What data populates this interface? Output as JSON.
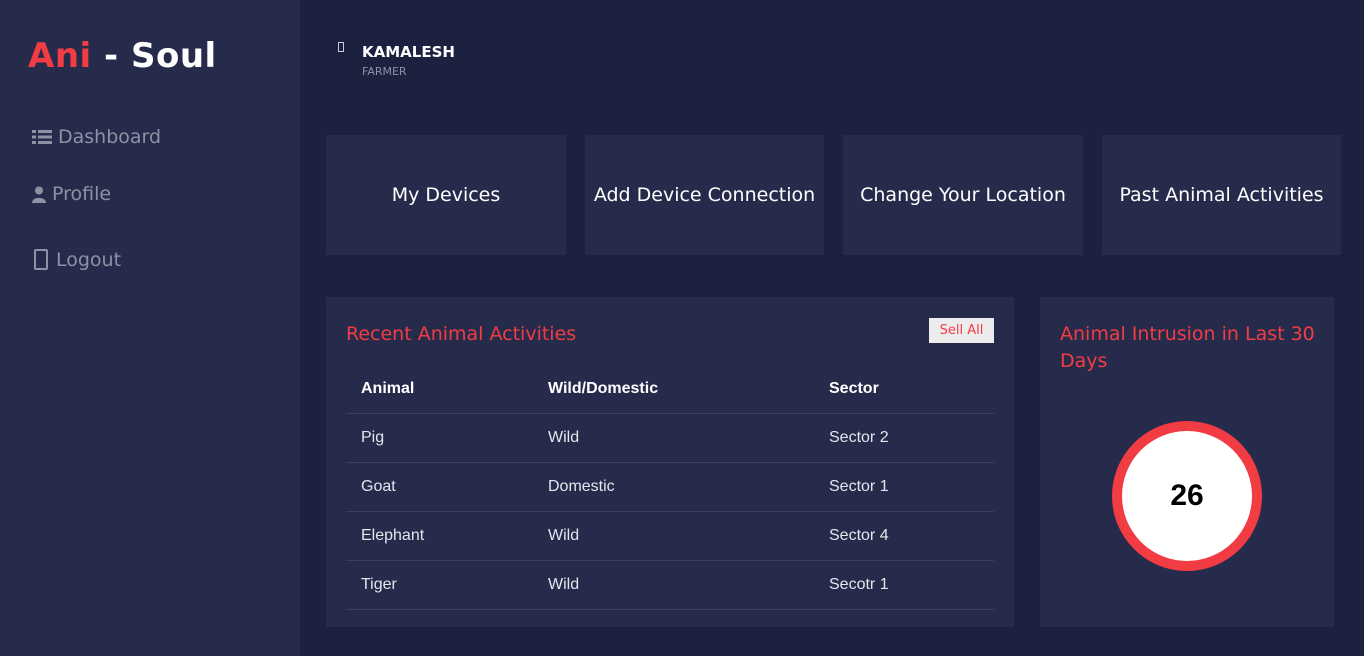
{
  "brand": {
    "accent": "Ani",
    "rest": " - Soul",
    "accent_color": "#f23c44"
  },
  "sidebar": {
    "items": [
      {
        "label": "Dashboard",
        "icon": "list-icon"
      },
      {
        "label": "Profile",
        "icon": "user-icon"
      },
      {
        "label": "Logout",
        "icon": "phone-icon"
      }
    ]
  },
  "user": {
    "name": "KAMALESH",
    "role": "FARMER"
  },
  "quick_actions": [
    {
      "label": "My Devices"
    },
    {
      "label": "Add Device Connection"
    },
    {
      "label": "Change Your Location"
    },
    {
      "label": "Past Animal Activities"
    }
  ],
  "recent_activities": {
    "title": "Recent Animal Activities",
    "see_all_label": "Sell All",
    "columns": [
      "Animal",
      "Wild/Domestic",
      "Sector"
    ],
    "rows": [
      [
        "Pig",
        "Wild",
        "Sector 2"
      ],
      [
        "Goat",
        "Domestic",
        "Sector 1"
      ],
      [
        "Elephant",
        "Wild",
        "Sector 4"
      ],
      [
        "Tiger",
        "Wild",
        "Secotr 1"
      ]
    ]
  },
  "intrusion": {
    "title": "Animal Intrusion in Last 30 Days",
    "value": "26"
  },
  "colors": {
    "background": "#1d2140",
    "panel": "#272b4b",
    "accent": "#f23c44",
    "muted_text": "#8e91a4"
  }
}
